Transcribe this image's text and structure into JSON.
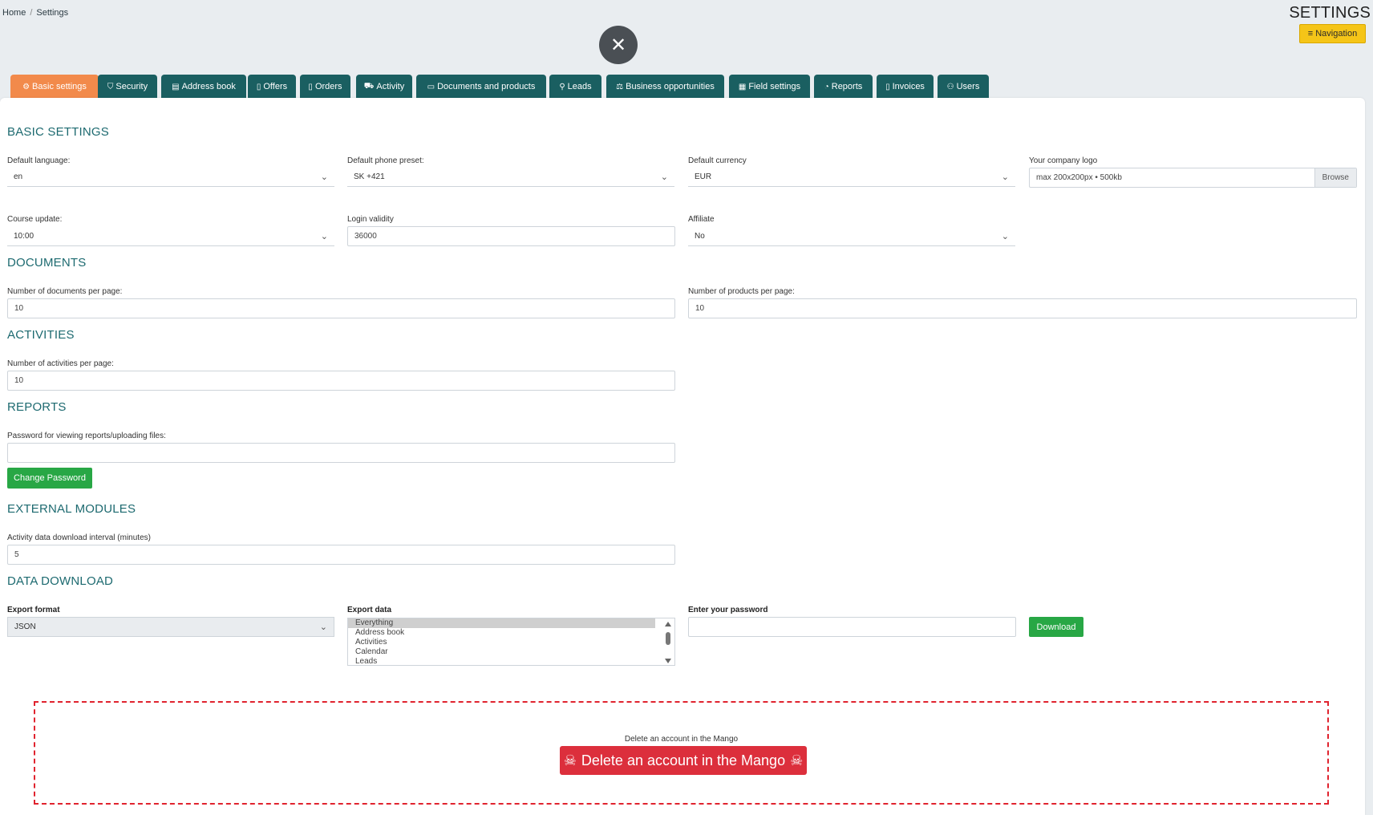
{
  "breadcrumb": {
    "home": "Home",
    "separator": "/",
    "current": "Settings"
  },
  "page_title": "SETTINGS",
  "navigation_button": {
    "icon": "≡",
    "label": "Navigation"
  },
  "close_button": {
    "icon": "✕"
  },
  "tabs": [
    {
      "icon": "⚙",
      "label": "Basic settings",
      "active": true
    },
    {
      "icon": "⛉",
      "label": "Security"
    },
    {
      "icon": "▤",
      "label": "Address book"
    },
    {
      "icon": "▯",
      "label": "Offers"
    },
    {
      "icon": "▯",
      "label": "Orders"
    },
    {
      "icon": "⛟",
      "label": "Activity"
    },
    {
      "icon": "▭",
      "label": "Documents and products"
    },
    {
      "icon": "⚲",
      "label": "Leads"
    },
    {
      "icon": "⚖",
      "label": "Business opportunities"
    },
    {
      "icon": "▦",
      "label": "Field settings"
    },
    {
      "icon": "◔",
      "label": "Reports"
    },
    {
      "icon": "▯",
      "label": "Invoices"
    },
    {
      "icon": "⚇",
      "label": "Users"
    }
  ],
  "basic": {
    "title": "BASIC SETTINGS",
    "language_label": "Default language:",
    "language_value": "en",
    "phone_label": "Default phone preset:",
    "phone_value": "SK +421",
    "currency_label": "Default currency",
    "currency_value": "EUR",
    "logo_label": "Your company logo",
    "logo_placeholder": "max 200x200px • 500kb",
    "browse_label": "Browse",
    "course_label": "Course update:",
    "course_value": "10:00",
    "login_label": "Login validity",
    "login_value": "36000",
    "affiliate_label": "Affiliate",
    "affiliate_value": "No"
  },
  "documents": {
    "title": "DOCUMENTS",
    "docs_label": "Number of documents per page:",
    "docs_value": "10",
    "products_label": "Number of products per page:",
    "products_value": "10"
  },
  "activities": {
    "title": "ACTIVITIES",
    "label": "Number of activities per page:",
    "value": "10"
  },
  "reports": {
    "title": "REPORTS",
    "password_label": "Password for viewing reports/uploading files:",
    "password_value": "",
    "change_button": "Change Password"
  },
  "external": {
    "title": "EXTERNAL MODULES",
    "interval_label": "Activity data download interval (minutes)",
    "interval_value": "5"
  },
  "download": {
    "title": "DATA DOWNLOAD",
    "format_label": "Export format",
    "format_value": "JSON",
    "export_label": "Export data",
    "export_options": [
      "Everything",
      "Address book",
      "Activities",
      "Calendar",
      "Leads"
    ],
    "password_label": "Enter your password",
    "password_value": "",
    "download_button": "Download"
  },
  "danger": {
    "label": "Delete an account in the Mango",
    "button": "Delete an account in the Mango",
    "icon": "☠"
  },
  "colors": {
    "tab": "#1a5f61",
    "tab_active": "#f28a4b",
    "heading": "#1d6a70",
    "green": "#28a745",
    "danger": "#dc2f3c",
    "nav_button": "#f5c518"
  }
}
